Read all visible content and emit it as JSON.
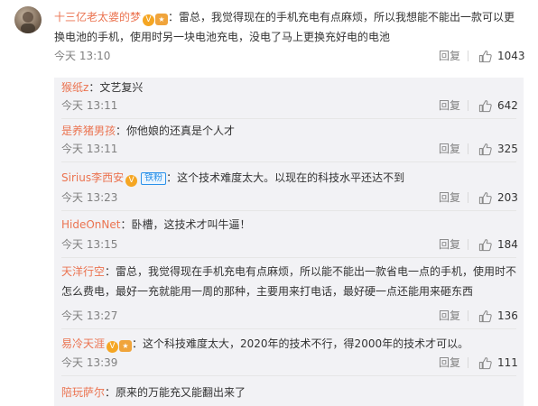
{
  "main_comment": {
    "author": "十三亿老太婆的梦",
    "badge": "V",
    "text": "：雷总，我觉得现在的手机充电有点麻烦，所以我想能不能出一款可以更换电池的手机，使用时另一块电池充电，没电了马上更换充好电的电池",
    "time": "今天 13:10",
    "reply_label": "回复",
    "likes": "1043"
  },
  "replies": [
    {
      "author": "猴纸z",
      "text": "：文艺复兴",
      "time": "今天 13:11",
      "reply_label": "回复",
      "likes": "642"
    },
    {
      "author": "是养猪男孩",
      "text": "：你他娘的还真是个人才",
      "time": "今天 13:11",
      "reply_label": "回复",
      "likes": "325"
    },
    {
      "author": "Sirius李西安",
      "badge": "V",
      "fan_badge": "铁粉",
      "text": "：这个技术难度太大。以现在的科技水平还达不到",
      "time": "今天 13:23",
      "reply_label": "回复",
      "likes": "203"
    },
    {
      "author": "HideOnNet",
      "text": "：卧槽，这技术才叫牛逼！",
      "time": "今天 13:15",
      "reply_label": "回复",
      "likes": "184"
    },
    {
      "author": "天洋行空",
      "text": "：雷总，我觉得现在手机充电有点麻烦，所以能不能出一款省电一点的手机，使用时不怎么费电，最好一充就能用一周的那种，主要用来打电话，最好硬一点还能用来砸东西",
      "time": "今天 13:27",
      "reply_label": "回复",
      "likes": "136"
    },
    {
      "author": "易冷天涯",
      "badge": "V",
      "text": "：这个科技难度太大，2020年的技术不行，得2000年的技术才可以。",
      "time": "今天 13:39",
      "reply_label": "回复",
      "likes": "111"
    },
    {
      "author": "陪玩萨尔",
      "text": "：原来的万能充又能翻出来了"
    }
  ],
  "colors": {
    "username": "#eb7350",
    "reply_bg": "#f2f2f5",
    "meta": "#808080"
  },
  "icons": {
    "like": "thumbs-up-icon",
    "vip": "v-badge-icon"
  }
}
